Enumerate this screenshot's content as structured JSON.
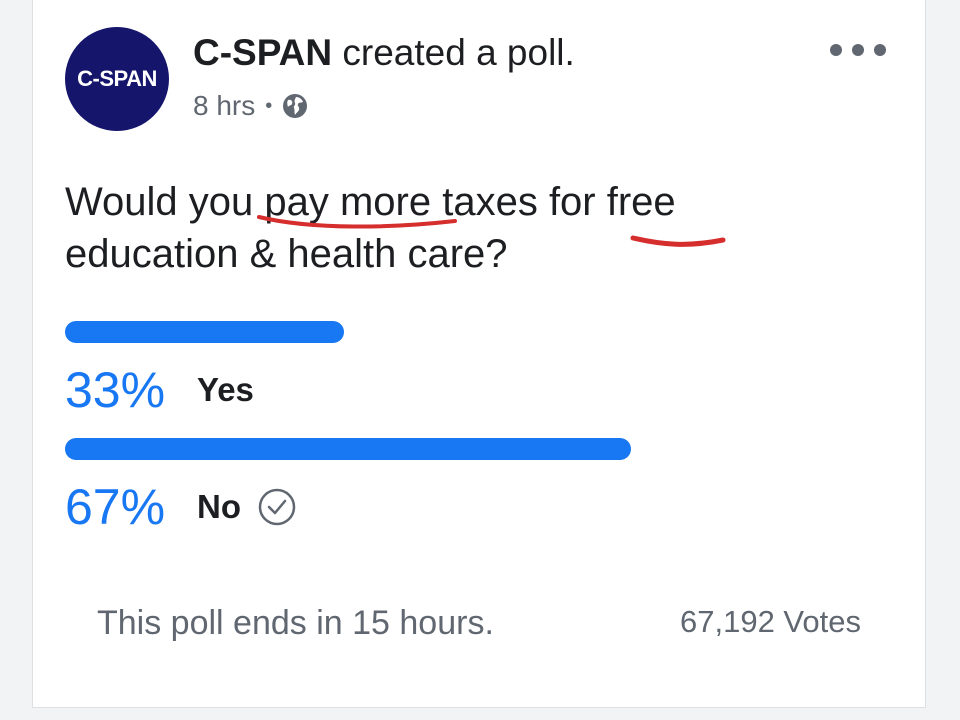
{
  "post": {
    "avatar_text": "C-SPAN",
    "page_name": "C-SPAN",
    "action_text": "created a poll.",
    "time": "8 hrs",
    "separator": "•",
    "privacy_icon": "globe-icon",
    "more_icon": "more-dots-icon"
  },
  "poll": {
    "question": "Would you pay more taxes for free education & health care?",
    "options": [
      {
        "percent_label": "33%",
        "label": "Yes",
        "share": 0.33,
        "selected": false
      },
      {
        "percent_label": "67%",
        "label": "No",
        "share": 0.67,
        "selected": true
      }
    ],
    "ends_text": "This poll ends in 15 hours.",
    "votes_text": "67,192 Votes"
  },
  "colors": {
    "accent": "#1877f2",
    "avatar_bg": "#14156b",
    "text": "#1c1e21",
    "muted": "#606770",
    "annotation": "#d62d2d"
  }
}
